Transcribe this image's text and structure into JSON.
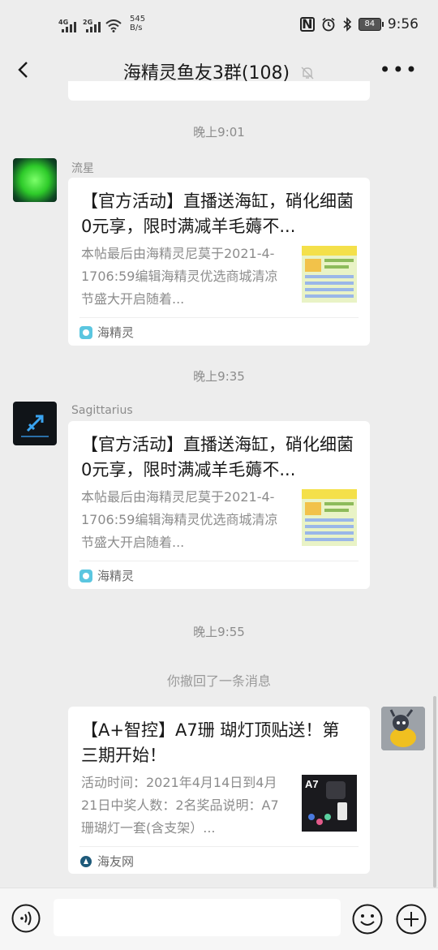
{
  "status_bar": {
    "net1": "4G",
    "net2": "2G",
    "speed_value": "545",
    "speed_unit": "B/s",
    "battery": "84",
    "time": "9:56"
  },
  "header": {
    "title": "海精灵鱼友3群(108)",
    "back_icon": "back-arrow-icon",
    "mute_icon": "bell-off-icon",
    "more_label": "•••"
  },
  "messages": [
    {
      "time": "晚上9:01",
      "sender": "流星",
      "card": {
        "title": "【官方活动】直播送海缸，硝化细菌0元享，限时满减羊毛薅不...",
        "desc": "本帖最后由海精灵尼莫于2021-4-1706:59编辑海精灵优选商城清凉节盛大开启随着...",
        "source": "海精灵"
      }
    },
    {
      "time": "晚上9:35",
      "sender": "Sagittarius",
      "card": {
        "title": "【官方活动】直播送海缸，硝化细菌0元享，限时满减羊毛薅不...",
        "desc": "本帖最后由海精灵尼莫于2021-4-1706:59编辑海精灵优选商城清凉节盛大开启随着...",
        "source": "海精灵"
      }
    },
    {
      "time": "晚上9:55",
      "recall": "你撤回了一条消息",
      "card": {
        "title": "【A+智控】A7珊 瑚灯顶贴送！第三期开始！",
        "desc": "活动时间：2021年4月14日到4月21日中奖人数：2名奖品说明：A7珊瑚灯一套(含支架）...",
        "thumb_label": "A7",
        "source": "海友网"
      }
    }
  ],
  "input_bar": {
    "voice_icon": "voice-icon",
    "emoji_icon": "emoji-icon",
    "plus_icon": "plus-icon"
  },
  "colors": {
    "background": "#ededed",
    "card": "#ffffff",
    "muted_text": "#8c8c8c"
  }
}
